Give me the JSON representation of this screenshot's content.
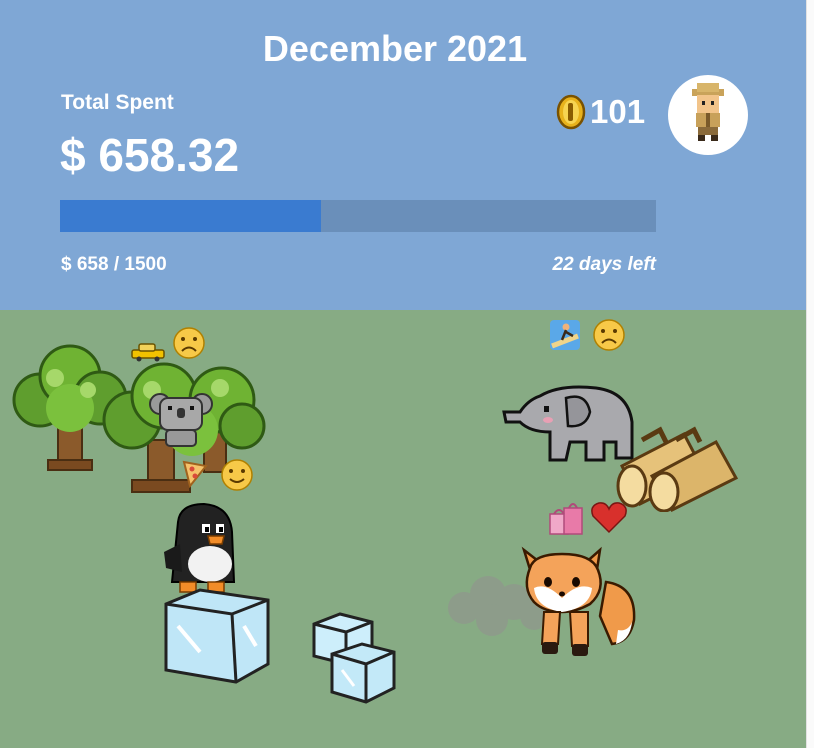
{
  "header": {
    "month_title": "December 2021",
    "total_label": "Total Spent",
    "total_amount": "$ 658.32",
    "coins": "101",
    "progress_label": "$ 658 / 1500",
    "days_left": "22 days left",
    "progress": {
      "spent": 658,
      "budget": 1500
    }
  },
  "colors": {
    "header_bg": "#7fa7d5",
    "progress_fill": "#3a7bd0",
    "progress_track": "#6a8fba",
    "field_bg": "#87ab84"
  },
  "avatar": {
    "icon": "explorer-avatar-icon"
  },
  "animals": [
    {
      "name": "koala",
      "icon": "koala-icon",
      "category_icon": "taxi-icon",
      "mood_icon": "frown-emoji-icon"
    },
    {
      "name": "elephant",
      "icon": "elephant-icon",
      "category_icon": "surfing-icon",
      "mood_icon": "frown-emoji-icon"
    },
    {
      "name": "penguin",
      "icon": "penguin-icon",
      "category_icon": "pizza-icon",
      "mood_icon": "smile-emoji-icon"
    },
    {
      "name": "fox",
      "icon": "fox-icon",
      "category_icon": "shopping-bags-icon",
      "mood_icon": "heart-icon"
    }
  ]
}
